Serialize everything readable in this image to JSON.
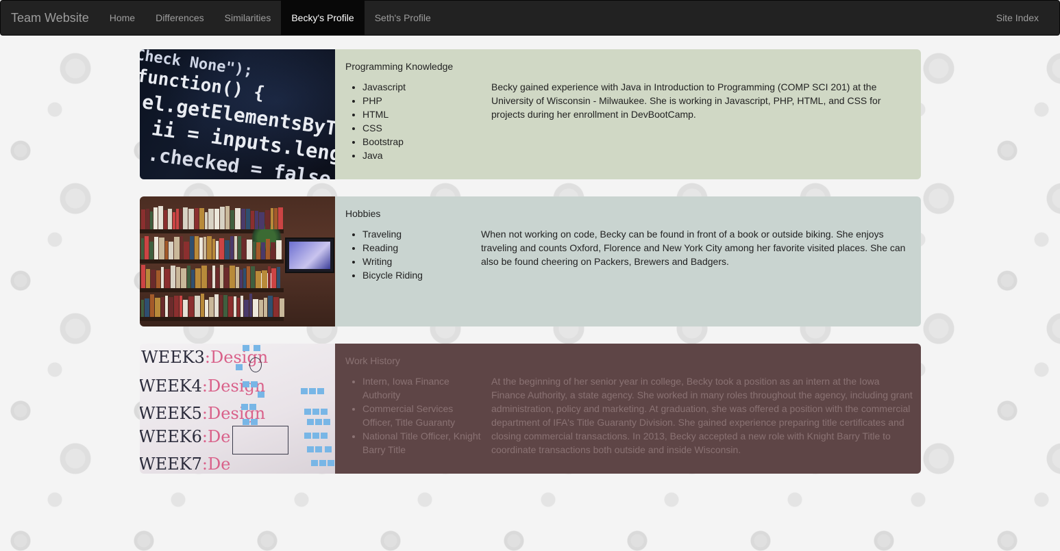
{
  "navbar": {
    "brand": "Team Website",
    "items": [
      {
        "label": "Home"
      },
      {
        "label": "Differences"
      },
      {
        "label": "Similarities"
      },
      {
        "label": "Becky's Profile",
        "active": true
      },
      {
        "label": "Seth's Profile"
      }
    ],
    "right_item": "Site Index"
  },
  "sections": [
    {
      "title": "Programming Knowledge",
      "items": [
        "Javascript",
        "PHP",
        "HTML",
        "CSS",
        "Bootstrap",
        "Java"
      ],
      "text": "Becky gained experience with Java in Introduction to Programming (COMP SCI 201) at the University of Wisconsin - Milwaukee. She is working in Javascript, PHP, HTML, and CSS for projects during her enrollment in DevBootCamp.",
      "image": "code-screen-photo",
      "color": "#d0d8c5"
    },
    {
      "title": "Hobbies",
      "items": [
        "Traveling",
        "Reading",
        "Writing",
        "Bicycle Riding"
      ],
      "text": "When not working on code, Becky can be found in front of a book or outside biking. She enjoys traveling and counts Oxford, Florence and New York City among her favorite visited places. She can also be found cheering on Packers, Brewers and Badgers.",
      "image": "bookshelf-photo",
      "color": "#c9d4d0"
    },
    {
      "title": "Work History",
      "items": [
        "Intern, Iowa Finance Authority",
        "Commercial Services Officer, Title Guaranty",
        "National Title Officer, Knight Barry Title"
      ],
      "text": "At the beginning of her senior year in college, Becky took a position as an intern at the Iowa Finance Authority, a state agency. She worked in many roles throughout the agency, including grant administration, policy and marketing. At graduation, she was offered a position with the commercial department of IFA's Title Guaranty Division. She gained experience preparing title certificates and closing commercial transactions. In 2013, Becky accepted a new role with Knight Barry Title to coordinate transactions both outside and inside Wisconsin.",
      "image": "whiteboard-photo",
      "color": "#5e4546"
    }
  ],
  "images": {
    "code_lines": [
      "Check None\");",
      "function() {",
      "el.getElementsByTag",
      "ii = inputs.leng",
      ".checked = false;"
    ],
    "board_weeks": [
      {
        "week": "WEEK3",
        "tag": "Design"
      },
      {
        "week": "WEEK4",
        "tag": "Design"
      },
      {
        "week": "WEEK5",
        "tag": "Design"
      },
      {
        "week": "WEEK6",
        "tag": "De"
      },
      {
        "week": "WEEK7",
        "tag": "De"
      }
    ]
  }
}
